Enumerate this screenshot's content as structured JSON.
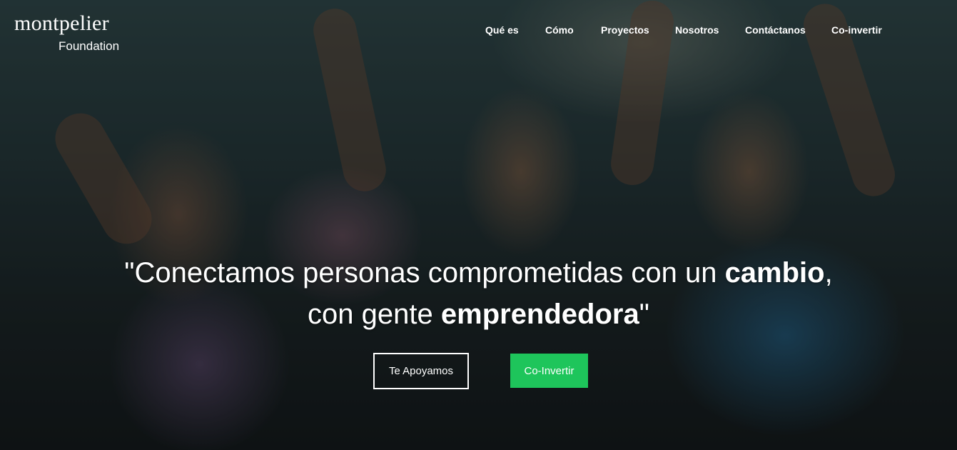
{
  "brand": {
    "name": "montpelier",
    "sub": "Foundation"
  },
  "nav": {
    "items": [
      {
        "label": "Qué es"
      },
      {
        "label": "Cómo"
      },
      {
        "label": "Proyectos"
      },
      {
        "label": "Nosotros"
      },
      {
        "label": "Contáctanos"
      },
      {
        "label": "Co-invertir"
      }
    ]
  },
  "hero": {
    "line1_pre": "\"Conectamos personas comprometidas con un ",
    "line1_bold": "cambio",
    "line1_post": ",",
    "line2_pre": "con gente ",
    "line2_bold": "emprendedora",
    "line2_post": "\""
  },
  "cta": {
    "primary_label": "Te Apoyamos",
    "secondary_label": "Co-Invertir"
  },
  "colors": {
    "accent_green": "#1ec55b",
    "text": "#ffffff"
  }
}
